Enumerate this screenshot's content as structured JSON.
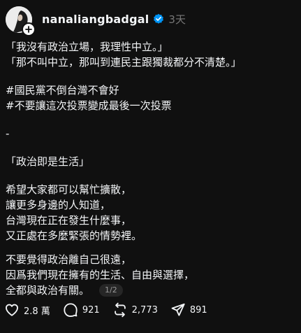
{
  "post": {
    "username": "nanaliangbadgal",
    "timestamp": "3天",
    "lines": [
      "「我沒有政治立場，我理性中立。」",
      "「那不叫中立，那叫到連民主跟獨裁都分不清楚。」",
      "#國民黨不倒台灣不會好",
      "#不要讓這次投票變成最後一次投票",
      "-",
      "「政治即是生活」",
      "希望大家都可以幫忙擴散，",
      "讓更多身邊的人知道，",
      "台灣現在正在發生什麼事，",
      "又正處在多麼緊張的情勢裡。",
      "不要覺得政治離自己很遠，",
      "因爲我們現在擁有的生活、自由與選擇，",
      "全都與政治有關。"
    ],
    "page_indicator": "1/2"
  },
  "actions": {
    "likes": "2.8 萬",
    "comments": "921",
    "reposts": "2,773",
    "shares": "891"
  },
  "icons": {
    "avatar": "avatar",
    "follow": "plus-icon",
    "verified": "verified-badge-icon",
    "like": "heart-icon",
    "comment": "comment-bubble-icon",
    "repost": "repost-icon",
    "share": "send-icon"
  },
  "colors": {
    "background": "#101010",
    "text": "#f3f5f7",
    "muted": "#777777",
    "verified": "#0095f6"
  }
}
